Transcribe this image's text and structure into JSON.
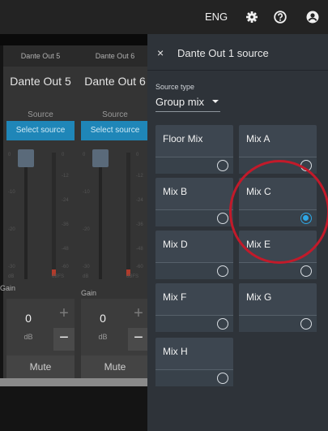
{
  "topbar": {
    "language": "ENG",
    "icons": [
      "gear-icon",
      "help-icon",
      "account-icon"
    ]
  },
  "mixer": {
    "strips": [
      {
        "header": "Dante Out 5",
        "name": "Dante Out 5",
        "source_label": "Source",
        "source_button": "Select source",
        "scale_left": [
          "0",
          "-10",
          "-20",
          "-30"
        ],
        "scale_right": [
          "0",
          "-12",
          "-24",
          "-36",
          "-48",
          "-60"
        ],
        "db_label": "dB",
        "dbfs_label": "dBFS",
        "gain_label": "Gain",
        "gain_value": "0",
        "gain_unit": "dB",
        "plus": "+",
        "minus": "−",
        "mute": "Mute"
      },
      {
        "header": "Dante Out 6",
        "name": "Dante Out 6",
        "source_label": "Source",
        "source_button": "Select source",
        "scale_left": [
          "0",
          "-10",
          "-20",
          "-30"
        ],
        "scale_right": [
          "0",
          "-12",
          "-24",
          "-36",
          "-48",
          "-60"
        ],
        "db_label": "dB",
        "dbfs_label": "dBFS",
        "gain_label": "Gain",
        "gain_value": "0",
        "gain_unit": "dB",
        "plus": "+",
        "minus": "−",
        "mute": "Mute"
      }
    ],
    "left_gain_label": "Gain"
  },
  "panel": {
    "close": "×",
    "title": "Dante Out 1 source",
    "source_type_label": "Source type",
    "source_type_value": "Group mix",
    "options": [
      {
        "label": "Floor Mix",
        "selected": false
      },
      {
        "label": "Mix A",
        "selected": false
      },
      {
        "label": "Mix B",
        "selected": false
      },
      {
        "label": "Mix C",
        "selected": true
      },
      {
        "label": "Mix D",
        "selected": false
      },
      {
        "label": "Mix E",
        "selected": false
      },
      {
        "label": "Mix F",
        "selected": false
      },
      {
        "label": "Mix G",
        "selected": false
      },
      {
        "label": "Mix H",
        "selected": false
      }
    ]
  },
  "colors": {
    "accent": "#2ea8e6",
    "highlight_ring": "#c21a2a",
    "source_button": "#1f86b8"
  }
}
